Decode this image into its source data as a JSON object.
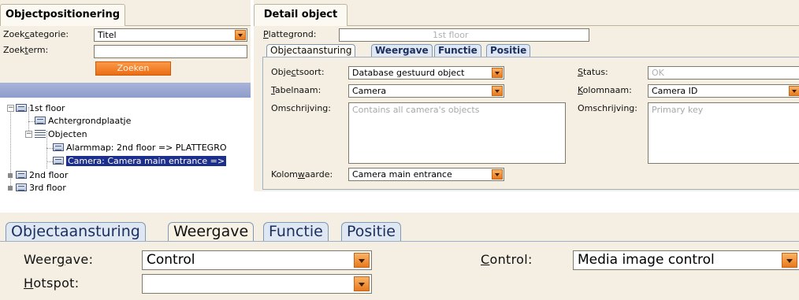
{
  "left_panel": {
    "tab_title": "Objectpositionering",
    "zoekcategorie_label_pre": "Zoek",
    "zoekcategorie_label_u": "c",
    "zoekcategorie_label_post": "ategorie:",
    "zoekcategorie_value": "Titel",
    "zoekterm_label_pre": "Zoek",
    "zoekterm_label_u": "t",
    "zoekterm_label_post": "erm:",
    "zoekterm_value": "",
    "zoeken_button": "Zoeken",
    "tree": [
      {
        "label": "1st floor"
      },
      {
        "label": "Achtergrondplaatje"
      },
      {
        "label": "Objecten"
      },
      {
        "label": "Alarmmap: 2nd floor => PLATTEGRO"
      },
      {
        "label": "Camera: Camera main entrance =>"
      },
      {
        "label": "2nd floor"
      },
      {
        "label": "3rd floor"
      }
    ]
  },
  "right_panel": {
    "tab_title": "Detail object",
    "plattegrond_label_u": "P",
    "plattegrond_label_post": "lattegrond:",
    "plattegrond_value": "1st floor",
    "tabs": [
      "Objectaansturing",
      "Weergave",
      "Functie",
      "Positie"
    ],
    "objectsoort_label_pre": "Obje",
    "objectsoort_label_u": "c",
    "objectsoort_label_post": "tsoort:",
    "objectsoort_value": "Database gestuurd object",
    "tabelnaam_label_u": "T",
    "tabelnaam_label_post": "abelnaam:",
    "tabelnaam_value": "Camera",
    "omschrijving_label": "Omschrijving:",
    "omschrijving_value": "Contains all camera's objects",
    "kolomwaarde_label_pre": "Kolom",
    "kolomwaarde_label_u": "w",
    "kolomwaarde_label_post": "aarde:",
    "kolomwaarde_value": "Camera main entrance",
    "status_label_u": "S",
    "status_label_post": "tatus:",
    "status_value": "OK",
    "kolomnaam_label_u": "K",
    "kolomnaam_label_post": "olomnaam:",
    "kolomnaam_value": "Camera ID",
    "omschrijving2_label": "Omschrijving:",
    "omschrijving2_value": "Primary key"
  },
  "zoom": {
    "tabs": [
      "Objectaansturing",
      "Weergave",
      "Functie",
      "Positie"
    ],
    "weergave_label_pre": "Weer",
    "weergave_label_u": "g",
    "weergave_label_post": "ave:",
    "weergave_value": "Control",
    "hotspot_label_u": "H",
    "hotspot_label_post": "otspot:",
    "hotspot_value": "",
    "control_label_u": "C",
    "control_label_post": "ontrol:",
    "control_value": "Media image control"
  },
  "colors": {
    "panel_bg": "#f4efe2",
    "accent_orange": "#ec6d14",
    "selection_blue": "#1c2f8c",
    "tab_blue": "#1b2f5f"
  }
}
